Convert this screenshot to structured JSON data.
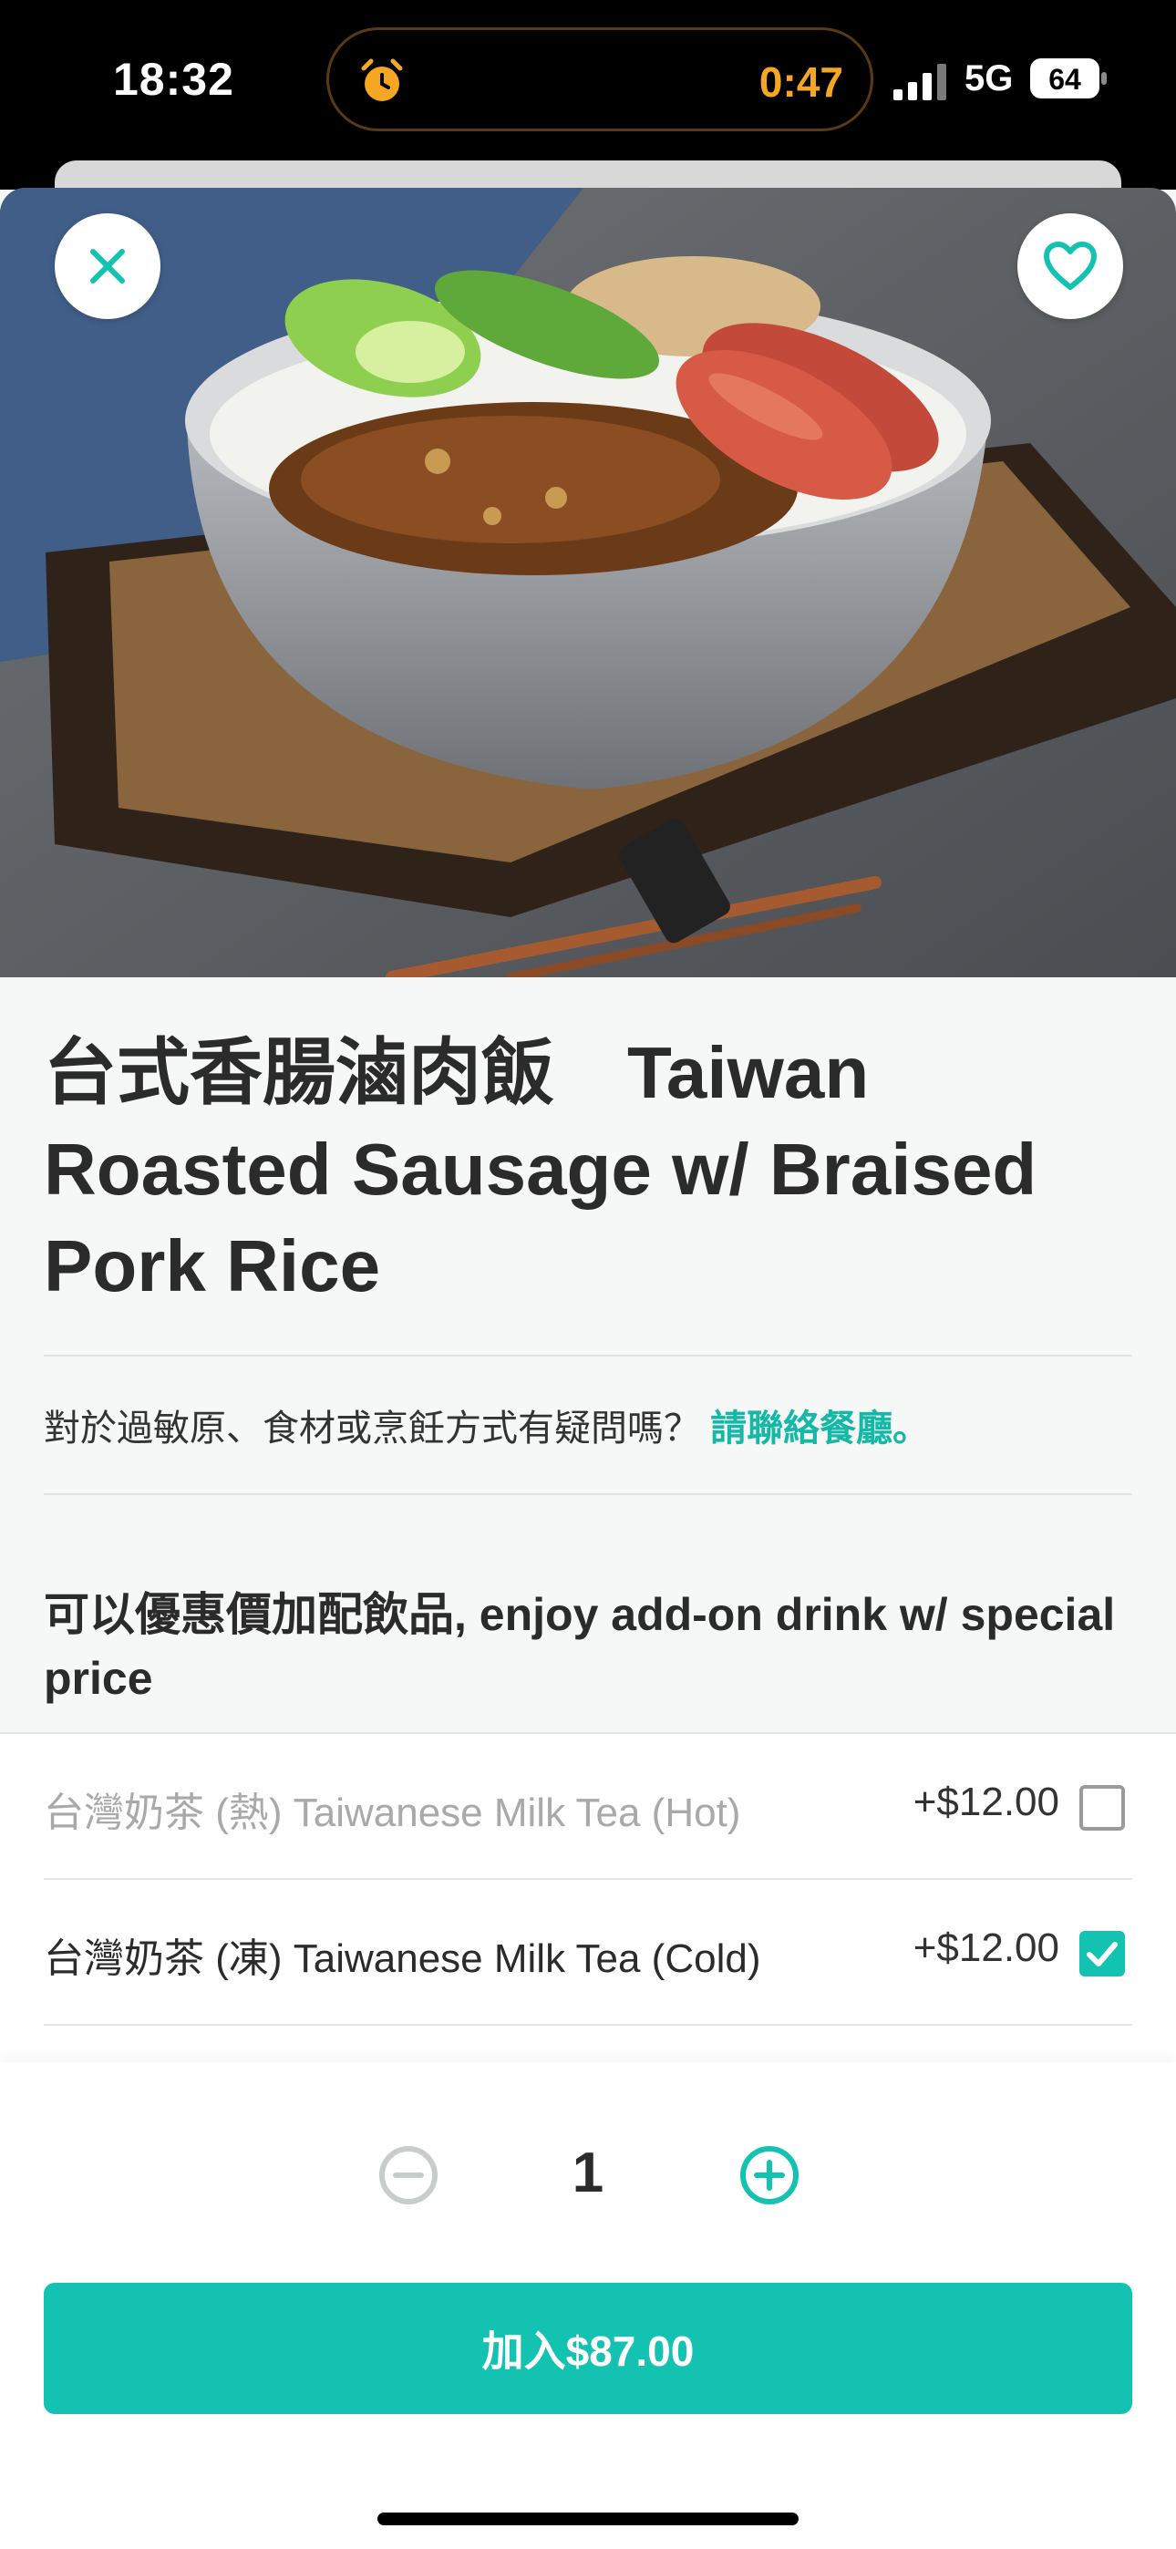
{
  "status_bar": {
    "time": "18:32",
    "timer": "0:47",
    "network": "5G",
    "battery": "64",
    "alarm_icon": "alarm-clock-icon",
    "signal_icon": "signal-bars-icon"
  },
  "hero": {
    "image": "braised-pork-rice-with-sausage-photo",
    "close_icon": "close-icon",
    "favorite_icon": "heart-icon"
  },
  "product": {
    "title": "台式香腸滷肉飯　Taiwan Roasted Sausage w/ Braised Pork Rice"
  },
  "allergen": {
    "question": "對於過敏原、食材或烹飪方式有疑問嗎？",
    "link": "請聯絡餐廳。"
  },
  "addon_section": {
    "title": "可以優惠價加配飲品, enjoy add-on drink w/ special price",
    "options": [
      {
        "name": "台灣奶茶 (熱) Taiwanese Milk Tea (Hot)",
        "price": "+$12.00",
        "checked": false
      },
      {
        "name": "台灣奶茶 (凍) Taiwanese Milk Tea (Cold)",
        "price": "+$12.00",
        "checked": true
      }
    ]
  },
  "quantity": {
    "value": "1"
  },
  "cta": {
    "label": "加入$87.00"
  },
  "colors": {
    "accent": "#13c2b0",
    "text": "#2b2b2b",
    "disabled": "#a9a9a9"
  }
}
